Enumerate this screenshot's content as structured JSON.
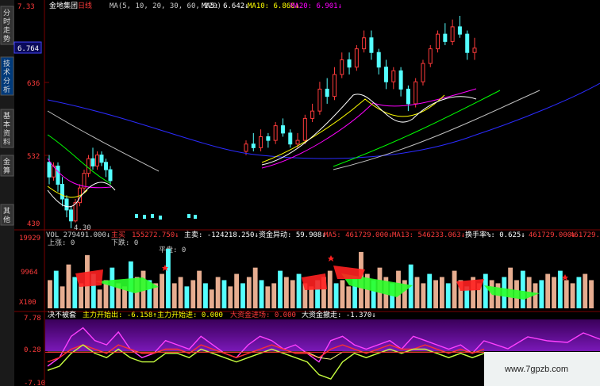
{
  "sidebar": {
    "tabs": [
      "分时走势",
      "技术分析",
      "基本资料",
      "金算",
      "其他"
    ],
    "price_box": "6.764"
  },
  "header": {
    "stock_name": "金地集团",
    "period": "日线",
    "ma_params": "MA(5, 10, 20, 30, 60, 120)",
    "ma5": "MA5: 6.642↓",
    "ma10": "MA10: 6.860↓",
    "ma20": "MA20: 6.901↓",
    "price_top_label": "7.33"
  },
  "volume_header": {
    "vol": "VOL 279491.000↓",
    "zhumai_label": "主买",
    "zhumai_value": "155272.750↓",
    "zhumai2": "主卖: -124218.250↓",
    "zijin": "资金异动: 59.908↓",
    "ma5": "MA5: 461729.000↓",
    "ma13": "MA13: 546233.063↓",
    "turnover": "换手率%: 0.625↓",
    "right_val": "461729.000↓",
    "right_val2": "461729.000"
  },
  "volume_sub": {
    "shangzhang": "上涨: 0",
    "xiadie": "下跌: 0",
    "pingpan": "平盘: 0"
  },
  "indicator_header": {
    "name": "决不被套",
    "item1": "主力开始出: -6.158↑",
    "item2": "主力开始进: 0.000",
    "item3": "大资金进场: 0.000",
    "item4": "大资金撤走: -1.370↓"
  },
  "axes": {
    "price_ticks": [
      "636",
      "532",
      "430"
    ],
    "vol_ticks": [
      "19929",
      "9964",
      "X100"
    ],
    "ind_ticks": [
      "7.78",
      "0.28",
      "-7.10"
    ],
    "low_label": "4.30"
  },
  "watermark": "www.7gpzb.com",
  "colors": {
    "up": "#ff3b3b",
    "down": "#54ffff",
    "ma5": "#ffffff",
    "ma10": "#ffff00",
    "ma20": "#ff00ff",
    "ma30": "#00ff00",
    "ma60": "#c0c0c0",
    "ma120": "#2b2bff"
  },
  "chart_data": [
    {
      "type": "candlestick",
      "title": "金地集团 日线",
      "ylim": [
        4.3,
        7.33
      ],
      "y_ticks_labels": [
        "636",
        "532",
        "430"
      ],
      "series": [
        {
          "name": "MA5",
          "last": 6.642
        },
        {
          "name": "MA10",
          "last": 6.86
        },
        {
          "name": "MA20",
          "last": 6.901
        }
      ],
      "candles": [
        [
          5.2,
          5.0,
          5.3,
          4.9
        ],
        [
          5.0,
          5.15,
          5.2,
          4.95
        ],
        [
          5.15,
          4.9,
          5.2,
          4.8
        ],
        [
          4.9,
          4.7,
          5.0,
          4.6
        ],
        [
          4.7,
          4.55,
          4.75,
          4.45
        ],
        [
          4.55,
          4.4,
          4.6,
          4.3
        ],
        [
          4.4,
          4.65,
          4.7,
          4.38
        ],
        [
          4.65,
          4.85,
          4.9,
          4.6
        ],
        [
          4.85,
          5.05,
          5.1,
          4.8
        ],
        [
          5.05,
          5.25,
          5.3,
          5.0
        ],
        [
          5.25,
          5.15,
          5.4,
          5.1
        ],
        [
          5.15,
          5.3,
          5.35,
          5.1
        ],
        [
          5.3,
          5.2,
          5.35,
          5.15
        ],
        [
          5.2,
          5.1,
          5.25,
          5.0
        ],
        [
          5.1,
          4.95,
          5.15,
          4.9
        ],
        [
          5.35,
          5.45,
          5.5,
          5.3
        ],
        [
          5.45,
          5.4,
          5.6,
          5.35
        ],
        [
          5.4,
          5.55,
          5.65,
          5.35
        ],
        [
          5.55,
          5.5,
          5.6,
          5.4
        ],
        [
          5.5,
          5.7,
          5.75,
          5.45
        ],
        [
          5.7,
          5.6,
          5.8,
          5.55
        ],
        [
          5.6,
          5.45,
          5.65,
          5.4
        ],
        [
          5.45,
          5.5,
          5.6,
          5.4
        ],
        [
          5.5,
          5.8,
          5.85,
          5.45
        ],
        [
          5.8,
          5.9,
          6.0,
          5.75
        ],
        [
          5.9,
          6.2,
          6.3,
          5.85
        ],
        [
          6.2,
          6.1,
          6.35,
          6.0
        ],
        [
          6.1,
          6.4,
          6.5,
          6.05
        ],
        [
          6.4,
          6.6,
          6.7,
          6.35
        ],
        [
          6.6,
          6.5,
          6.7,
          6.4
        ],
        [
          6.5,
          6.75,
          6.8,
          6.45
        ],
        [
          6.75,
          6.9,
          7.0,
          6.7
        ],
        [
          6.9,
          6.7,
          7.0,
          6.6
        ],
        [
          6.7,
          6.5,
          6.75,
          6.4
        ],
        [
          6.5,
          6.3,
          6.6,
          6.2
        ],
        [
          6.3,
          6.45,
          6.5,
          6.2
        ],
        [
          6.45,
          6.2,
          6.5,
          6.1
        ],
        [
          6.2,
          6.0,
          6.25,
          5.9
        ],
        [
          6.0,
          6.3,
          6.35,
          5.95
        ],
        [
          6.3,
          6.55,
          6.6,
          6.25
        ],
        [
          6.55,
          6.75,
          6.8,
          6.5
        ],
        [
          6.75,
          6.95,
          7.0,
          6.7
        ],
        [
          6.95,
          6.85,
          7.1,
          6.8
        ],
        [
          6.85,
          7.05,
          7.15,
          6.8
        ],
        [
          7.05,
          6.95,
          7.2,
          6.9
        ],
        [
          6.95,
          6.7,
          7.0,
          6.6
        ],
        [
          6.7,
          6.76,
          6.9,
          6.6
        ]
      ]
    },
    {
      "type": "bar",
      "title": "VOL",
      "ylim": [
        0,
        19929
      ],
      "values": [
        9,
        12,
        7,
        14,
        10,
        8,
        17,
        11,
        6,
        9,
        13,
        8,
        7,
        15,
        10,
        12,
        9,
        8,
        11,
        19,
        8,
        10,
        7,
        9,
        12,
        8,
        6,
        10,
        9,
        7,
        11,
        8,
        10,
        13,
        9,
        7,
        8,
        12,
        10,
        9,
        11,
        8,
        7,
        9,
        10,
        12,
        8,
        9,
        7,
        10,
        18,
        11,
        9,
        13,
        10,
        8,
        12,
        9,
        14,
        10,
        8,
        11,
        9,
        10,
        8,
        12,
        9,
        7,
        10,
        8,
        11,
        9,
        8,
        10,
        13,
        9,
        12,
        10,
        8,
        9,
        11,
        10,
        12,
        9,
        8,
        10,
        11,
        9
      ]
    },
    {
      "type": "line",
      "title": "决不被套",
      "ylim": [
        -7.1,
        7.78
      ],
      "series": [
        {
          "name": "主力开始出",
          "values": [
            -3,
            -1,
            4,
            6,
            3,
            2,
            5,
            1,
            -1,
            0,
            3,
            2,
            1,
            4,
            2,
            0,
            -1,
            2,
            4,
            3,
            1,
            2,
            0,
            -2,
            3,
            4,
            2,
            1,
            2,
            3,
            1,
            4,
            3,
            2,
            1,
            2,
            0,
            3
          ]
        },
        {
          "name": "主力开始进",
          "values": [
            -2,
            -1,
            1,
            2,
            1,
            0,
            2,
            1,
            0,
            0,
            1,
            1,
            0,
            2,
            1,
            0,
            -1,
            0,
            1,
            2,
            1,
            0,
            0,
            -1,
            1,
            2,
            1,
            0,
            1,
            2,
            1,
            1,
            2,
            1,
            0,
            1,
            0,
            1
          ]
        },
        {
          "name": "大资金进场",
          "values": [
            -4,
            -3,
            0,
            2,
            0,
            -1,
            1,
            -1,
            -2,
            -2,
            0,
            0,
            -1,
            1,
            0,
            -1,
            -2,
            -1,
            0,
            1,
            0,
            -1,
            -2,
            -5,
            -6,
            -2,
            0,
            -1,
            0,
            1,
            0,
            1,
            1,
            0,
            -1,
            0,
            -1,
            0
          ]
        },
        {
          "name": "大资金撤走",
          "values": [
            0.3,
            0.3,
            0.3,
            0.3,
            0.3,
            0.3,
            0.3,
            0.3,
            0.3,
            0.3,
            0.3,
            0.3,
            0.3,
            0.3,
            0.3,
            0.3,
            0.3,
            0.3,
            0.3,
            0.3,
            0.3,
            0.3,
            0.3,
            -1.0,
            -1.37,
            0.3,
            0.3,
            0.3,
            0.3,
            0.3,
            0.3,
            0.3,
            0.3,
            0.3,
            0.3,
            0.3,
            0.3,
            0.3
          ]
        }
      ]
    }
  ]
}
